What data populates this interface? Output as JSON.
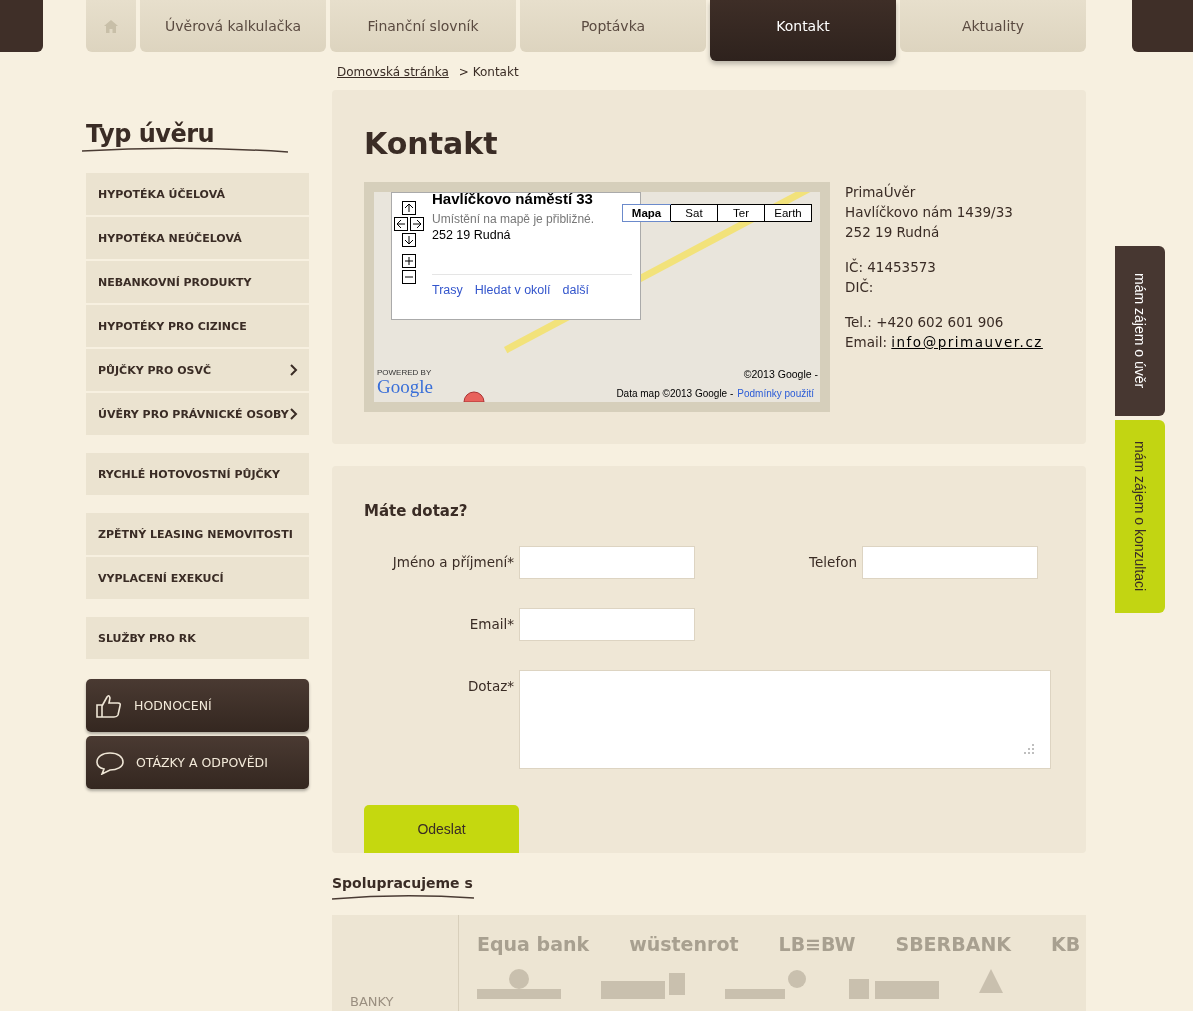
{
  "nav": {
    "tabs": [
      {
        "kind": "home",
        "selected": false
      },
      {
        "kind": "text",
        "label": "Úvěrová kalkulačka",
        "selected": false
      },
      {
        "kind": "text",
        "label": "Finanční slovník",
        "selected": false
      },
      {
        "kind": "text",
        "label": "Poptávka",
        "selected": false
      },
      {
        "kind": "text",
        "label": "Kontakt",
        "selected": true
      },
      {
        "kind": "text",
        "label": "Aktuality",
        "selected": false
      }
    ]
  },
  "breadcrumb": {
    "link": "Domovská stránka",
    "current": "> Kontakt"
  },
  "sidebar": {
    "title": "Typ úvěru",
    "groups": [
      [
        {
          "label": "HYPOTÉKA ÚČELOVÁ",
          "has_submenu": false
        },
        {
          "label": "HYPOTÉKA NEÚČELOVÁ",
          "has_submenu": false
        },
        {
          "label": "NEBANKOVNÍ PRODUKTY",
          "has_submenu": false
        },
        {
          "label": "HYPOTÉKY PRO CIZINCE",
          "has_submenu": false
        },
        {
          "label": "PŮJČKY PRO OSVČ",
          "has_submenu": true
        },
        {
          "label": "ÚVĚRY PRO PRÁVNICKÉ OSOBY",
          "has_submenu": true
        }
      ],
      [
        {
          "label": "RYCHLÉ HOTOVOSTNÍ PŮJČKY",
          "has_submenu": false
        }
      ],
      [
        {
          "label": "ZPĚTNÝ LEASING NEMOVITOSTI",
          "has_submenu": false
        },
        {
          "label": "VYPLACENÍ EXEKUCÍ",
          "has_submenu": false
        }
      ],
      [
        {
          "label": "SLUŽBY PRO RK",
          "has_submenu": false
        }
      ]
    ],
    "buttons": [
      {
        "kind": "thumb",
        "label": "HODNOCENÍ"
      },
      {
        "kind": "bubble",
        "label": "OTÁZKY A ODPOVĚDI"
      }
    ]
  },
  "contact": {
    "title": "Kontakt",
    "map": {
      "popup": {
        "title": "Havlíčkovo náměstí 33",
        "note": "Umístění na mapě je přibližné.",
        "address": "252 19 Rudná",
        "links": [
          "Trasy",
          "Hledat v okolí",
          "další"
        ]
      },
      "map_types": [
        {
          "label": "Mapa",
          "selected": true
        },
        {
          "label": "Sat",
          "selected": false
        },
        {
          "label": "Ter",
          "selected": false
        },
        {
          "label": "Earth",
          "selected": false
        }
      ],
      "powered": "POWERED BY",
      "logo": "Google",
      "copyright": "©2013 Google -",
      "data_note": "Data map ©2013 Google -",
      "terms": "Podmínky použití"
    },
    "address_blocks": [
      [
        "PrimaÚvěr",
        "Havlíčkovo nám 1439/33",
        "252 19 Rudná"
      ],
      [
        "IČ: 41453573",
        "DIČ:"
      ]
    ],
    "phone": "Tel.: +420 602 601 906",
    "email_label": "Email:",
    "email": "info@primauver.cz"
  },
  "form": {
    "title": "Máte dotaz?",
    "rows": [
      [
        {
          "kind": "input",
          "label": "Jméno a příjmení*"
        },
        {
          "kind": "input",
          "label": "Telefon"
        }
      ],
      [
        {
          "kind": "input",
          "label": "Email*"
        }
      ],
      [
        {
          "kind": "textarea",
          "label": "Dotaz*"
        }
      ]
    ],
    "submit": "Odeslat"
  },
  "partners": {
    "title": "Spolupracujeme s",
    "category": "BANKY",
    "logos": [
      "Equa bank",
      "wüstenrot",
      "LB≡BW",
      "SBERBANK",
      "KB"
    ]
  },
  "side_tabs": [
    {
      "kind": "dark",
      "label": "mám zájem o úvěr"
    },
    {
      "kind": "green",
      "label": "mám zájem o konzultaci"
    }
  ]
}
